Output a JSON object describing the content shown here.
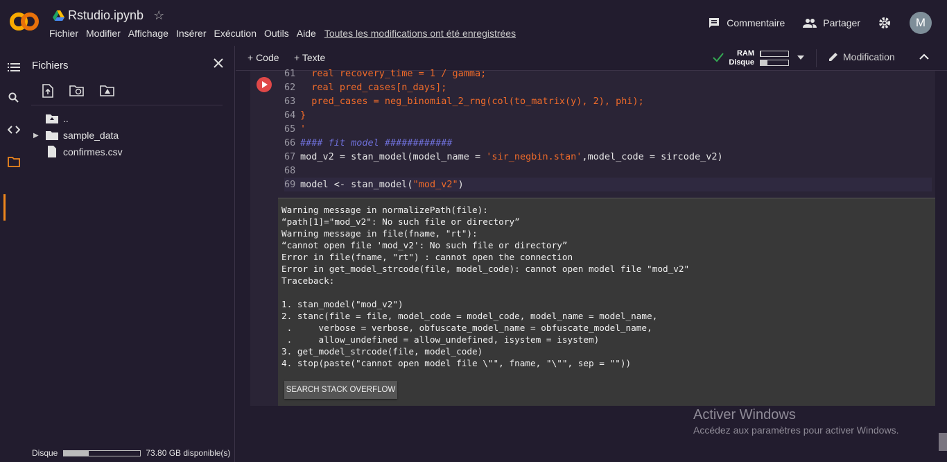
{
  "header": {
    "doc_title": "Rstudio.ipynb",
    "menu": [
      "Fichier",
      "Modifier",
      "Affichage",
      "Insérer",
      "Exécution",
      "Outils",
      "Aide"
    ],
    "save_status": "Toutes les modifications ont été enregistrées",
    "comment_label": "Commentaire",
    "share_label": "Partager",
    "avatar_letter": "M"
  },
  "sidebar": {
    "title": "Fichiers",
    "tree": [
      {
        "name": "..",
        "type": "parent"
      },
      {
        "name": "sample_data",
        "type": "folder"
      },
      {
        "name": "confirmes.csv",
        "type": "file"
      }
    ],
    "disk_label": "Disque",
    "disk_free": "73.80 GB disponible(s)",
    "disk_used_fraction": 0.32
  },
  "toolbar": {
    "add_code": "+ Code",
    "add_text": "+ Texte",
    "ram_label": "RAM",
    "disk_label": "Disque",
    "ram_fraction": 0.02,
    "disk_fraction": 0.25,
    "edit_label": "Modification"
  },
  "code_lines": [
    {
      "n": "61",
      "parts": [
        {
          "t": "  real recovery_time = 1 / gamma;",
          "c": "red"
        }
      ]
    },
    {
      "n": "62",
      "parts": [
        {
          "t": "  real pred_cases[n_days];",
          "c": "red"
        }
      ]
    },
    {
      "n": "63",
      "parts": [
        {
          "t": "  pred_cases = neg_binomial_2_rng(col(to_matrix(y), 2), phi);",
          "c": "red"
        }
      ]
    },
    {
      "n": "64",
      "parts": [
        {
          "t": "}",
          "c": "red"
        }
      ]
    },
    {
      "n": "65",
      "parts": [
        {
          "t": "'",
          "c": "red"
        }
      ]
    },
    {
      "n": "66",
      "parts": [
        {
          "t": "#### fit model ############",
          "c": "cmt"
        }
      ]
    },
    {
      "n": "67",
      "parts": [
        {
          "t": "mod_v2 = stan_model(model_name = ",
          "c": "plain"
        },
        {
          "t": "'sir_negbin.stan'",
          "c": "str"
        },
        {
          "t": ",model_code = sircode_v2)",
          "c": "plain"
        }
      ]
    },
    {
      "n": "68",
      "parts": []
    },
    {
      "n": "69",
      "parts": [
        {
          "t": "model <- stan_model(",
          "c": "plain"
        },
        {
          "t": "\"mod_v2\"",
          "c": "str"
        },
        {
          "t": ")",
          "c": "plain"
        }
      ]
    }
  ],
  "output_lines": [
    "Warning message in normalizePath(file):",
    "“path[1]=\"mod_v2\": No such file or directory”",
    "Warning message in file(fname, \"rt\"):",
    "“cannot open file 'mod_v2': No such file or directory”",
    "Error in file(fname, \"rt\") : cannot open the connection",
    "Error in get_model_strcode(file, model_code): cannot open model file \"mod_v2\"",
    "Traceback:",
    "",
    "1. stan_model(\"mod_v2\")",
    "2. stanc(file = file, model_code = model_code, model_name = model_name,",
    " .     verbose = verbose, obfuscate_model_name = obfuscate_model_name,",
    " .     allow_undefined = allow_undefined, isystem = isystem)",
    "3. get_model_strcode(file, model_code)",
    "4. stop(paste(\"cannot open model file \\\"\", fname, \"\\\"\", sep = \"\"))"
  ],
  "so_button": "SEARCH STACK OVERFLOW",
  "watermark": {
    "title": "Activer Windows",
    "subtitle": "Accédez aux paramètres pour activer Windows."
  },
  "colors": {
    "accent_orange": "#f0871c",
    "run_red": "#e04848",
    "code_red": "#f06b2a",
    "comment": "#6e6fd8"
  }
}
